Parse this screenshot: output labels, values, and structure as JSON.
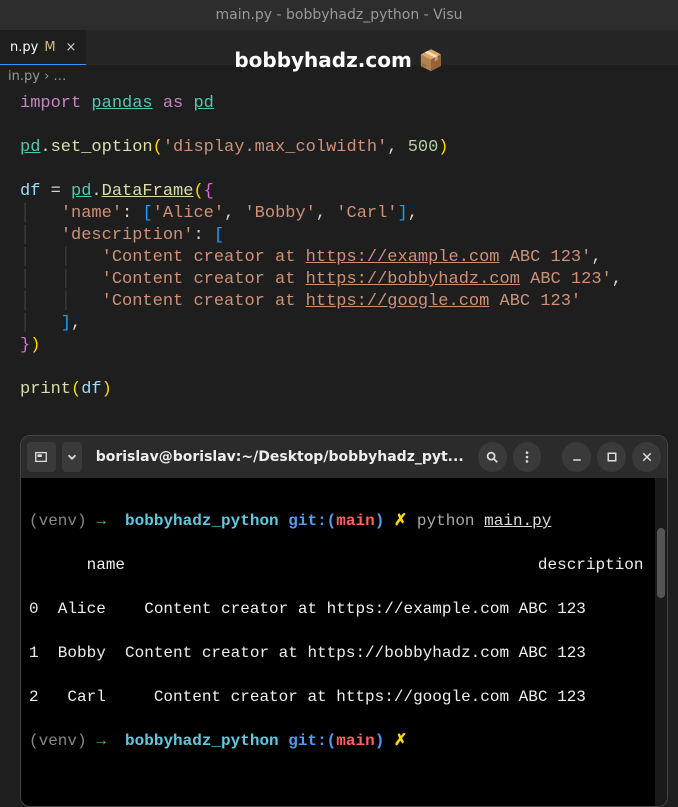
{
  "window_title": "main.py - bobbyhadz_python - Visu",
  "tab": {
    "filename": "n.py",
    "modified_badge": "M",
    "close": "×"
  },
  "breadcrumb": {
    "file": "in.py",
    "sep": "›",
    "more": "…"
  },
  "watermark": {
    "text": "bobbyhadz.com",
    "icon": "📦"
  },
  "code": {
    "l1_import": "import",
    "l1_pandas": "pandas",
    "l1_as": "as",
    "l1_pd": "pd",
    "l3_pd": "pd",
    "l3_dot": ".",
    "l3_setopt": "set_option",
    "l3_open": "(",
    "l3_arg1": "'display.max_colwidth'",
    "l3_comma": ", ",
    "l3_arg2": "500",
    "l3_close": ")",
    "l5_df": "df",
    "l5_eq": " = ",
    "l5_pd": "pd",
    "l5_dot": ".",
    "l5_dataframe": "DataFrame",
    "l5_open": "(",
    "l5_brace": "{",
    "l6_key": "'name'",
    "l6_colon": ": ",
    "l6_br": "[",
    "l6_a": "'Alice'",
    "l6_c1": ", ",
    "l6_b": "'Bobby'",
    "l6_c2": ", ",
    "l6_c": "'Carl'",
    "l6_cb": "]",
    "l6_comma": ",",
    "l7_key": "'description'",
    "l7_colon": ": ",
    "l7_br": "[",
    "l8_pre": "'Content creator at ",
    "l8_url": "https://example.com",
    "l8_post": " ABC 123'",
    "l8_comma": ",",
    "l9_pre": "'Content creator at ",
    "l9_url": "https://bobbyhadz.com",
    "l9_post": " ABC 123'",
    "l9_comma": ",",
    "l10_pre": "'Content creator at ",
    "l10_url": "https://google.com",
    "l10_post": " ABC 123'",
    "l11_cb": "]",
    "l11_comma": ",",
    "l12_brace": "}",
    "l12_close": ")",
    "l14_print": "print",
    "l14_open": "(",
    "l14_df": "df",
    "l14_close": ")"
  },
  "terminal": {
    "title": "borislav@borislav:~/Desktop/bobbyhadz_pyt...",
    "prompt": {
      "venv": "(venv)",
      "arrow": "→",
      "dir": "bobbyhadz_python",
      "git": "git:",
      "branch_open": "(",
      "branch": "main",
      "branch_close": ")",
      "x": "✗"
    },
    "cmd": "python",
    "file": "main.py",
    "out_header": "      name                                           description",
    "out_row0": "0  Alice    Content creator at https://example.com ABC 123",
    "out_row1": "1  Bobby  Content creator at https://bobbyhadz.com ABC 123",
    "out_row2": "2   Carl     Content creator at https://google.com ABC 123"
  }
}
